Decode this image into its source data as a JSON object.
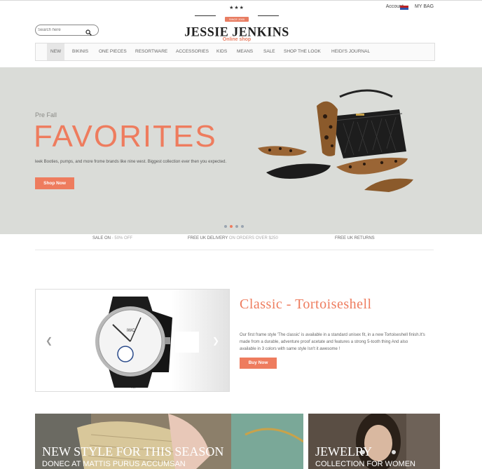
{
  "header": {
    "account_label": "Account",
    "bag_label": "MY BAG",
    "search_placeholder": "Search here"
  },
  "logo": {
    "ribbon": "SINCE 2000",
    "name": "JESSIE JENKINS",
    "tagline": "Online shop"
  },
  "nav": {
    "items": [
      "NEW",
      "BIKINIS",
      "ONE PIECES",
      "RESORTWARE",
      "ACCESSORIES",
      "KIDS",
      "MEANS",
      "SALE",
      "SHOP THE LOOK",
      "HEIDI'S JOURNAL"
    ],
    "active_index": 0
  },
  "hero": {
    "kicker": "Pre Fall",
    "title": "FAVORITES",
    "text": "leek Booties, pumps, and more frome brands like nine west. Biggest collection ever then you expected.",
    "cta": "Shop Now",
    "slides": 4,
    "active_slide": 1
  },
  "strip": {
    "sale": "SALE ON",
    "sale_value": "- 50% OFF",
    "delivery": "FREE UK DELIVERY",
    "delivery_rest": "ON ORDERS OVER $250",
    "returns": "FREE UK RETURNS"
  },
  "product": {
    "title": "Classic - Tortoiseshell",
    "description": "Our first frame style 'The classic' is available in a standard unisex fit, in a new Tortoiseshell finish.It's made from a durable, adventure proof acetate and features a strong 5-tooth thing And also available in 3 colors with same style Isn't it awesome !",
    "cta": "Buy Now",
    "image_caption": "..."
  },
  "banners": [
    {
      "title": "NEW STYLE FOR THIS SEASON",
      "subtitle": "DONEC AT MATTIS PURUS ACCUMSAN"
    },
    {
      "title": "JEWELRY",
      "subtitle": "COLLECTION FOR WOMEN"
    }
  ],
  "colors": {
    "accent": "#ee7c5e",
    "hero_bg": "#dadcd8"
  }
}
